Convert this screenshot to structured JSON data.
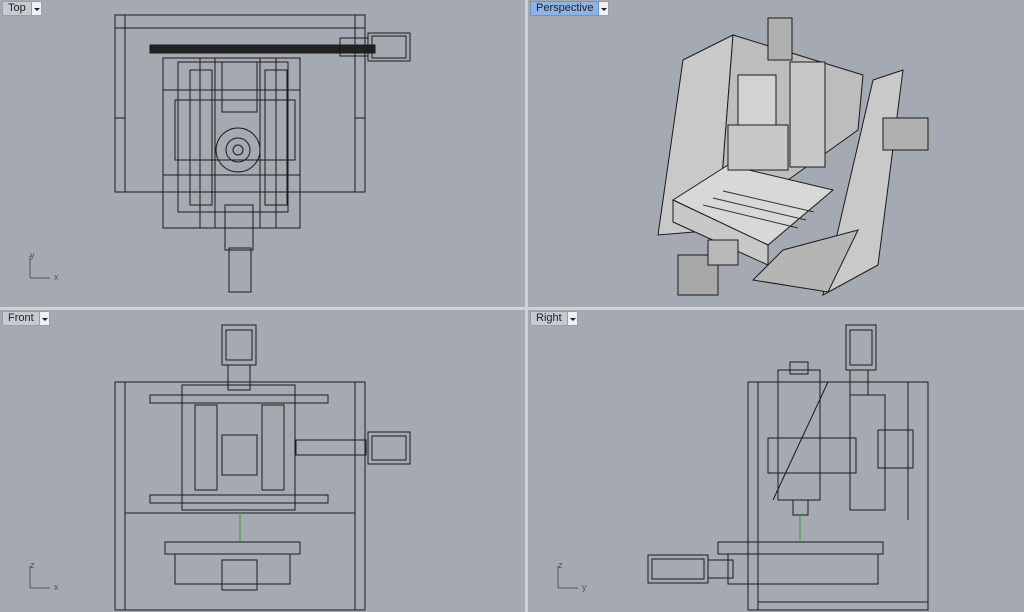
{
  "viewports": {
    "top": {
      "label": "Top",
      "axes": [
        "y",
        "x"
      ]
    },
    "perspective": {
      "label": "Perspective"
    },
    "front": {
      "label": "Front",
      "axes": [
        "z",
        "x"
      ]
    },
    "right": {
      "label": "Right",
      "axes": [
        "z",
        "y"
      ]
    }
  },
  "colors": {
    "viewport_bg": "#a5a9b2",
    "line": "#1b1b1b",
    "active_tab": "#8eb4e6",
    "axis_green": "#3c9a3c"
  }
}
